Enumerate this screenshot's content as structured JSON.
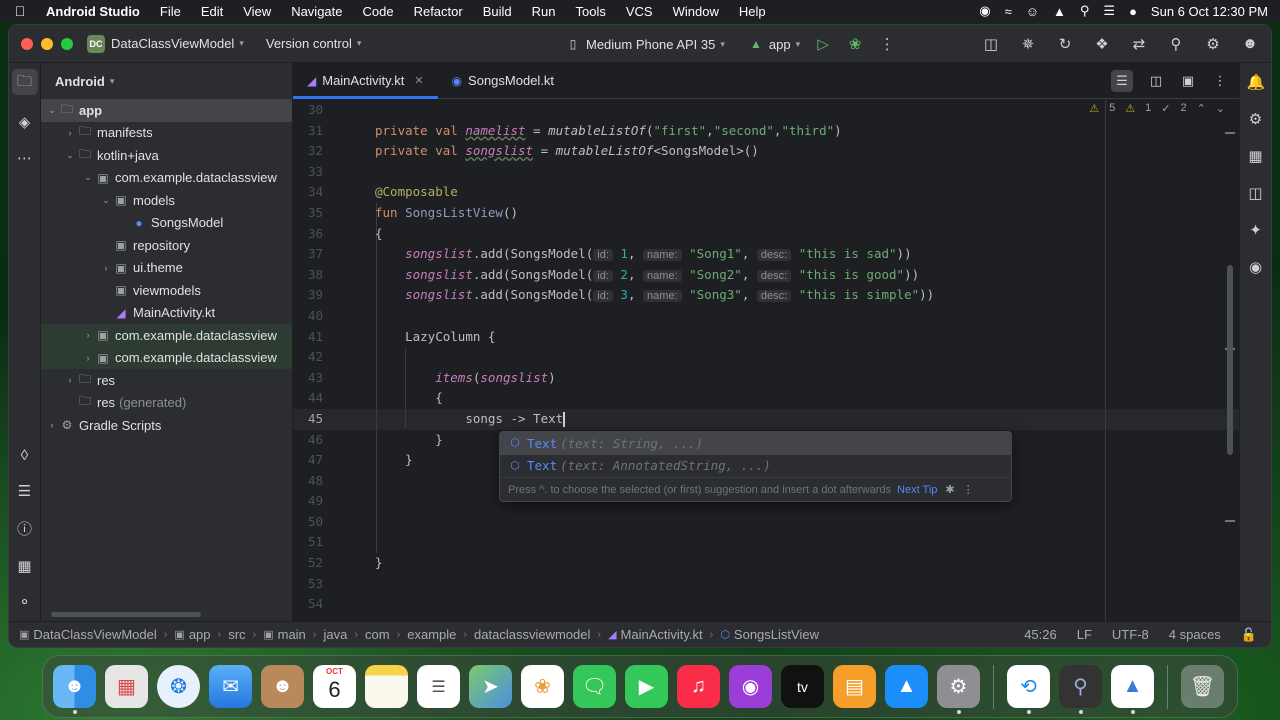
{
  "menubar": {
    "app_name": "Android Studio",
    "items": [
      "File",
      "Edit",
      "View",
      "Navigate",
      "Code",
      "Refactor",
      "Build",
      "Run",
      "Tools",
      "VCS",
      "Window",
      "Help"
    ],
    "clock": "Sun 6 Oct  12:30 PM"
  },
  "titlebar": {
    "project_badge": "DC",
    "project_name": "DataClassViewModel",
    "version_control": "Version control",
    "device": "Medium Phone API 35",
    "run_config": "app"
  },
  "project_panel": {
    "header": "Android",
    "tree": [
      {
        "label": "app",
        "type": "module",
        "expanded": true,
        "selected": true
      },
      {
        "label": "manifests",
        "type": "folder"
      },
      {
        "label": "kotlin+java",
        "type": "folder",
        "expanded": true
      },
      {
        "label": "com.example.dataclassview",
        "type": "package",
        "expanded": true
      },
      {
        "label": "models",
        "type": "package",
        "expanded": true
      },
      {
        "label": "SongsModel",
        "type": "class"
      },
      {
        "label": "repository",
        "type": "package"
      },
      {
        "label": "ui.theme",
        "type": "package"
      },
      {
        "label": "viewmodels",
        "type": "package"
      },
      {
        "label": "MainActivity.kt",
        "type": "kotlin"
      },
      {
        "label": "com.example.dataclassview",
        "type": "package"
      },
      {
        "label": "com.example.dataclassview",
        "type": "package"
      },
      {
        "label": "res",
        "type": "folder"
      },
      {
        "label": "res",
        "suffix": "(generated)",
        "type": "folder"
      },
      {
        "label": "Gradle Scripts",
        "type": "gradle"
      }
    ]
  },
  "tabs": [
    {
      "label": "MainActivity.kt",
      "active": true
    },
    {
      "label": "SongsModel.kt",
      "active": false
    }
  ],
  "inspections": {
    "warnings": "5",
    "weak_warnings": "1",
    "typos": "2"
  },
  "editor": {
    "line_numbers": [
      "30",
      "31",
      "32",
      "33",
      "34",
      "35",
      "36",
      "37",
      "38",
      "39",
      "40",
      "41",
      "42",
      "43",
      "44",
      "45",
      "46",
      "47",
      "48",
      "49",
      "50",
      "51",
      "52",
      "53",
      "54"
    ],
    "current_line": "45",
    "code": {
      "l31_a": "private val ",
      "l31_b": "namelist",
      "l31_c": " = ",
      "l31_d": "mutableListOf",
      "l31_e": "(",
      "l31_f": "\"first\"",
      "l31_g": ",",
      "l31_h": "\"second\"",
      "l31_i": ",",
      "l31_j": "\"third\"",
      "l31_k": ")",
      "l32_a": "private val ",
      "l32_b": "songslist",
      "l32_c": " = ",
      "l32_d": "mutableListOf",
      "l32_e": "<SongsModel>()",
      "l34": "@Composable",
      "l35_a": "fun ",
      "l35_b": "SongsListView",
      "l35_c": "()",
      "l36": "{",
      "song_lines": [
        {
          "id": "1",
          "name": "\"Song1\"",
          "desc": "\"this is sad\""
        },
        {
          "id": "2",
          "name": "\"Song2\"",
          "desc": "\"this is good\""
        },
        {
          "id": "3",
          "name": "\"Song3\"",
          "desc": "\"this is simple\""
        }
      ],
      "songslist": "songslist",
      "add_call": ".add(SongsModel(",
      "hint_id": "id:",
      "hint_name": "name:",
      "hint_desc": "desc:",
      "comma": ",",
      "close": "))",
      "l41": "LazyColumn {",
      "l43_a": "items",
      "l43_b": "(",
      "l43_c": "songslist",
      "l43_d": ")",
      "l44": "{",
      "l45": "songs -> Text",
      "l46": "}",
      "l47": "}",
      "l52": "}"
    }
  },
  "completion": {
    "items": [
      {
        "name": "Text",
        "signature": "(text: String, ...)"
      },
      {
        "name": "Text",
        "signature": "(text: AnnotatedString, ...)"
      }
    ],
    "footer": "Press ^. to choose the selected (or first) suggestion and insert a dot afterwards",
    "next_tip": "Next Tip"
  },
  "statusbar": {
    "breadcrumbs": [
      "DataClassViewModel",
      "app",
      "src",
      "main",
      "java",
      "com",
      "example",
      "dataclassviewmodel",
      "MainActivity.kt",
      "SongsListView"
    ],
    "position": "45:26",
    "line_ending": "LF",
    "encoding": "UTF-8",
    "indent": "4 spaces"
  },
  "dock": {
    "calendar_month": "OCT",
    "calendar_day": "6",
    "apps": [
      "Finder",
      "Launchpad",
      "Safari",
      "Mail",
      "Contacts",
      "Calendar",
      "Notes",
      "Reminders",
      "Maps",
      "Photos",
      "Messages",
      "FaceTime",
      "Music",
      "Podcasts",
      "TV",
      "Books",
      "App Store",
      "System Settings",
      "Edge",
      "QuickTime",
      "Android Studio",
      "Trash"
    ]
  }
}
